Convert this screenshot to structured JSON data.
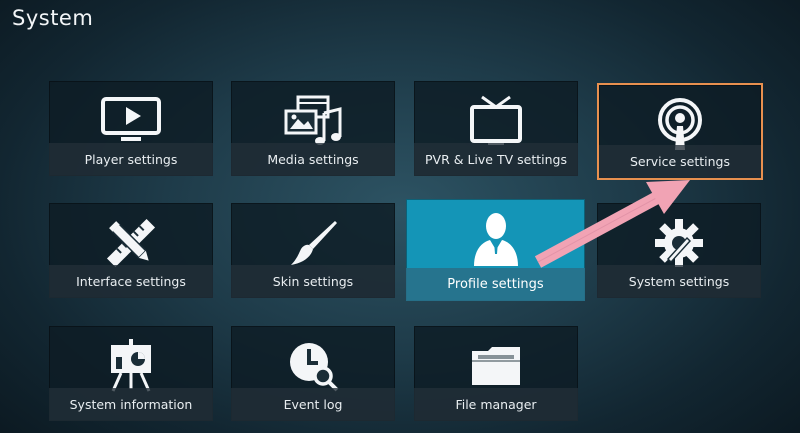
{
  "header": {
    "title": "System"
  },
  "tiles": [
    {
      "label": "Player settings",
      "icon": "monitor-play-icon"
    },
    {
      "label": "Media settings",
      "icon": "media-icon"
    },
    {
      "label": "PVR & Live TV settings",
      "icon": "tv-icon"
    },
    {
      "label": "Service settings",
      "icon": "broadcast-icon"
    },
    {
      "label": "Interface settings",
      "icon": "pencil-ruler-icon"
    },
    {
      "label": "Skin settings",
      "icon": "paintbrush-icon"
    },
    {
      "label": "Profile settings",
      "icon": "user-profile-icon"
    },
    {
      "label": "System settings",
      "icon": "gear-wrench-icon"
    },
    {
      "label": "System information",
      "icon": "presentation-board-icon"
    },
    {
      "label": "Event log",
      "icon": "clock-search-icon"
    },
    {
      "label": "File manager",
      "icon": "folder-icon"
    }
  ],
  "colors": {
    "accent": "#1495b7",
    "highlight_border": "#e8904f",
    "arrow": "#f1a3b4"
  }
}
